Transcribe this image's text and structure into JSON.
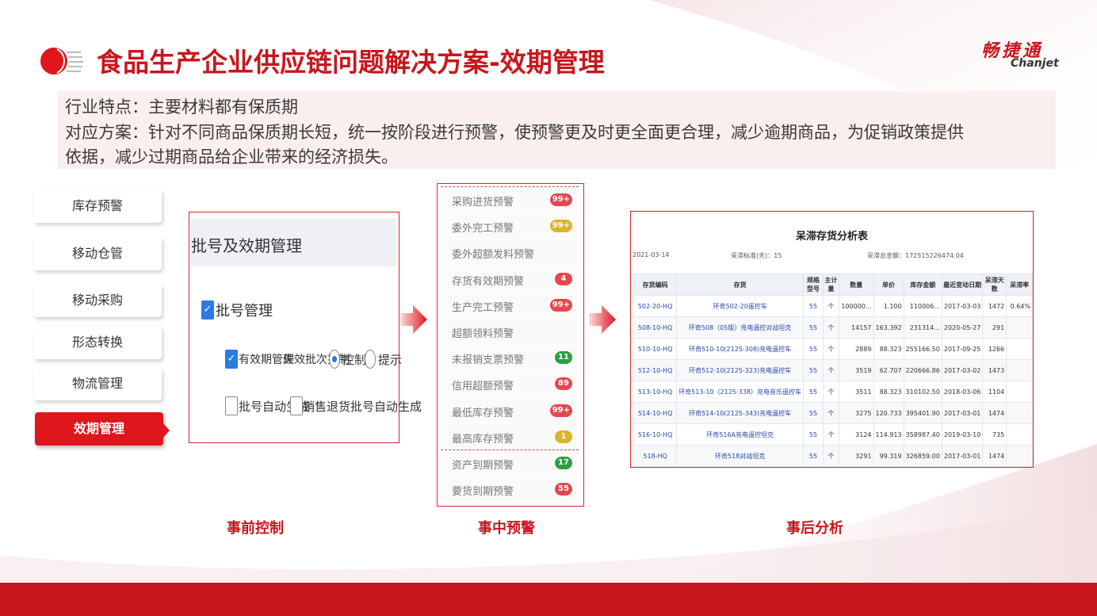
{
  "header": {
    "title": "食品生产企业供应链问题解决方案-效期管理",
    "brand_cn": "畅捷通",
    "brand_en": "Chanjet"
  },
  "description": {
    "line1": "行业特点：主要材料都有保质期",
    "line2": "对应方案：针对不同商品保质期长短，统一按阶段进行预警，使预警更及时更全面更合理，减少逾期商品，为促销政策提供",
    "line3": "依据，减少过期商品给企业带来的经济损失。"
  },
  "nav": {
    "items": [
      {
        "label": "库存预警"
      },
      {
        "label": "移动仓管"
      },
      {
        "label": "移动采购"
      },
      {
        "label": "形态转换"
      },
      {
        "label": "物流管理"
      },
      {
        "label": "效期管理"
      }
    ]
  },
  "panel_batch": {
    "title": "批号及效期管理",
    "batch_mgmt": "批号管理",
    "expiry_mgmt": "有效期管理",
    "expired_batch_ctrl": "失效批次控制",
    "opt_control": "控制",
    "opt_prompt": "提示",
    "auto_batch": "批号自动生成",
    "sales_return_auto": "销售退货批号自动生成"
  },
  "panel_alerts": {
    "items": [
      {
        "label": "采购进货预警",
        "badge": "99+",
        "color": "#e5474e"
      },
      {
        "label": "委外完工预警",
        "badge": "99+",
        "color": "#d9b52c"
      },
      {
        "label": "委外超额发料预警",
        "badge": "",
        "color": ""
      },
      {
        "label": "存货有效期预警",
        "badge": "4",
        "color": "#e5474e"
      },
      {
        "label": "生产完工预警",
        "badge": "99+",
        "color": "#e5474e"
      },
      {
        "label": "超额领料预警",
        "badge": "",
        "color": ""
      },
      {
        "label": "未报销支票预警",
        "badge": "11",
        "color": "#2e9e43"
      },
      {
        "label": "信用超额预警",
        "badge": "89",
        "color": "#e5474e"
      },
      {
        "label": "最低库存预警",
        "badge": "99+",
        "color": "#e5474e"
      },
      {
        "label": "最高库存预警",
        "badge": "1",
        "color": "#d9b52c"
      },
      {
        "label": "资产到期预警",
        "badge": "17",
        "color": "#2e9e43"
      },
      {
        "label": "要货到期预警",
        "badge": "55",
        "color": "#e5474e"
      }
    ]
  },
  "panel_report": {
    "title": "呆滞存货分析表",
    "date": "2021-03-14",
    "standard": "呆滞标准(天)：15",
    "total": "呆滞总金额：172515226474.04",
    "columns": [
      "存货编码",
      "存货",
      "规格型号",
      "主计量",
      "数量",
      "单价",
      "库存金额",
      "最近变动日期",
      "呆滞天数",
      "呆滞率"
    ],
    "rows": [
      [
        "502-20-HQ",
        "环奇502-20遥控车",
        "55",
        "个",
        "100000...",
        "1.100",
        "110006...",
        "2017-03-03",
        "1472",
        "0.64%"
      ],
      [
        "508-10-HQ",
        "环奇508（05版）充电遥控对战坦克",
        "55",
        "个",
        "14157",
        "163.392",
        "231314...",
        "2020-05-27",
        "291",
        ""
      ],
      [
        "510-10-HQ",
        "环奇510-10(2125-308)充电遥控车",
        "55",
        "个",
        "2889",
        "88.323",
        "255166.50",
        "2017-09-25",
        "1266",
        ""
      ],
      [
        "512-10-HQ",
        "环奇512-10(2125-323)充电遥控车",
        "55",
        "个",
        "3519",
        "62.707",
        "220666.86",
        "2017-03-02",
        "1473",
        ""
      ],
      [
        "513-10-HQ",
        "环奇513-10（2125-338）充电音乐遥控车",
        "55",
        "个",
        "3511",
        "88.323",
        "310102.50",
        "2018-03-06",
        "1104",
        ""
      ],
      [
        "514-10-HQ",
        "环奇514-10(2125-343)充电遥控车",
        "55",
        "个",
        "3275",
        "120.733",
        "395401.90",
        "2017-03-01",
        "1474",
        ""
      ],
      [
        "516-10-HQ",
        "环奇516A充电遥控坦克",
        "55",
        "个",
        "3124",
        "114.913",
        "358987.40",
        "2019-03-10",
        "735",
        ""
      ],
      [
        "518-HQ",
        "环奇518对战坦克",
        "55",
        "个",
        "3291",
        "99.319",
        "326859.00",
        "2017-03-01",
        "1474",
        ""
      ]
    ]
  },
  "captions": {
    "pre": "事前控制",
    "mid": "事中预警",
    "post": "事后分析"
  },
  "colors": {
    "brand_red": "#c8161d",
    "nav_active": "#e0161d",
    "link_blue": "#2846a8"
  }
}
